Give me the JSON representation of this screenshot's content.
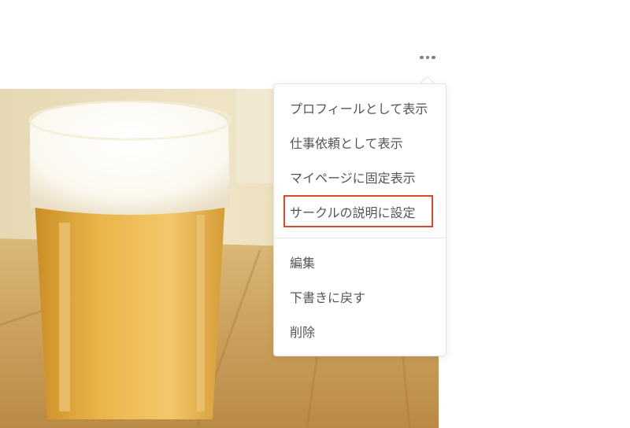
{
  "header": {
    "more_icon": "more-horizontal-icon"
  },
  "menu": {
    "items_top": [
      "プロフィールとして表示",
      "仕事依頼として表示",
      "マイページに固定表示",
      "サークルの説明に設定"
    ],
    "items_bottom": [
      "編集",
      "下書きに戻す",
      "削除"
    ],
    "highlight_color": "#e0462a"
  },
  "photo": {
    "icon": "beer-glass-photo"
  }
}
